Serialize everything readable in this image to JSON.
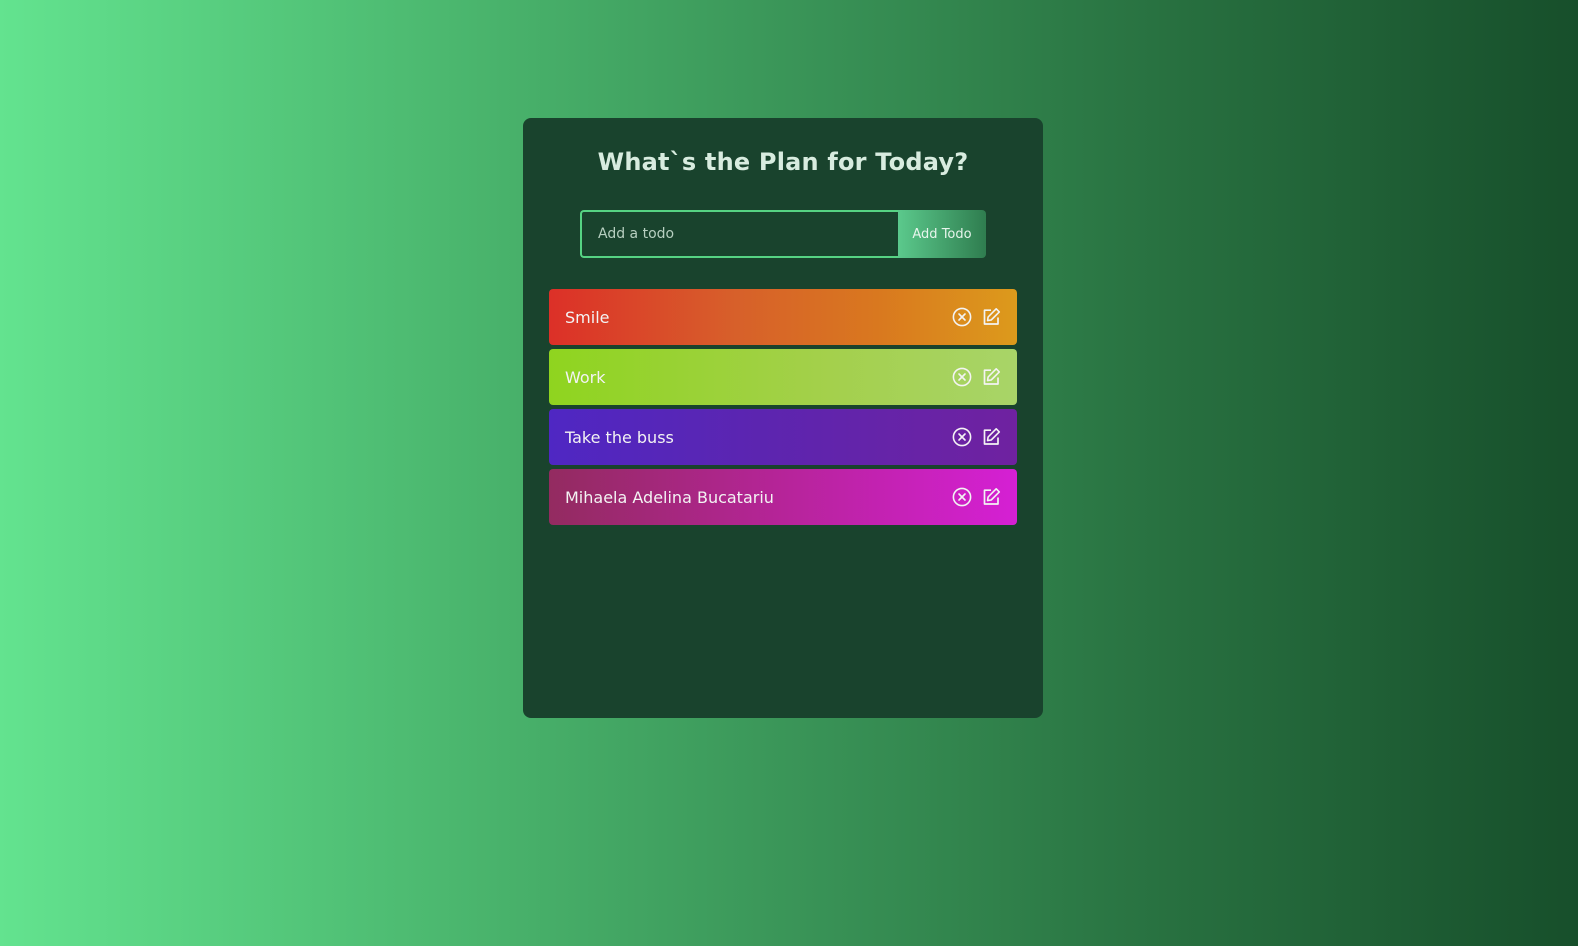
{
  "header": {
    "title": "What`s the Plan for Today?"
  },
  "form": {
    "placeholder": "Add a todo",
    "value": "",
    "button_label": "Add Todo"
  },
  "todos": [
    {
      "text": "Smile",
      "delete_icon": "circle-x-icon",
      "edit_icon": "edit-icon"
    },
    {
      "text": "Work",
      "delete_icon": "circle-x-icon",
      "edit_icon": "edit-icon"
    },
    {
      "text": "Take the buss",
      "delete_icon": "circle-x-icon",
      "edit_icon": "edit-icon"
    },
    {
      "text": "Mihaela Adelina Bucatariu",
      "delete_icon": "circle-x-icon",
      "edit_icon": "edit-icon"
    }
  ],
  "colors": {
    "panel": "#19432d",
    "input_border": "#56d383",
    "title_text": "#d8ecdf"
  }
}
